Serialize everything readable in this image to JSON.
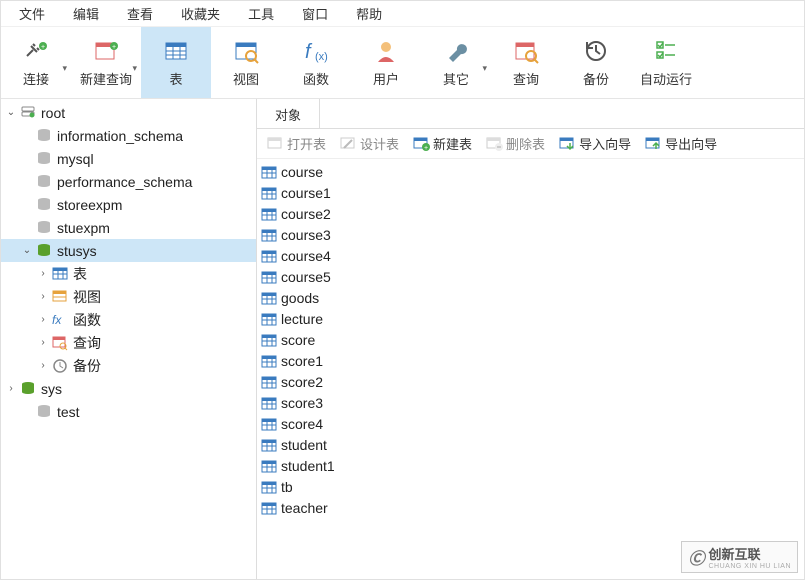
{
  "menu": [
    "文件",
    "编辑",
    "查看",
    "收藏夹",
    "工具",
    "窗口",
    "帮助"
  ],
  "toolbar": [
    {
      "label": "连接",
      "name": "connect",
      "icon": "plug",
      "drop": true,
      "active": false
    },
    {
      "label": "新建查询",
      "name": "new-query",
      "icon": "newq",
      "drop": true,
      "active": false
    },
    {
      "label": "表",
      "name": "tables",
      "icon": "table",
      "drop": false,
      "active": true
    },
    {
      "label": "视图",
      "name": "views",
      "icon": "view",
      "drop": false,
      "active": false
    },
    {
      "label": "函数",
      "name": "functions",
      "icon": "fx",
      "drop": false,
      "active": false
    },
    {
      "label": "用户",
      "name": "users",
      "icon": "user",
      "drop": false,
      "active": false
    },
    {
      "label": "其它",
      "name": "others",
      "icon": "wrench",
      "drop": true,
      "active": false
    },
    {
      "label": "查询",
      "name": "query",
      "icon": "query",
      "drop": false,
      "active": false
    },
    {
      "label": "备份",
      "name": "backup",
      "icon": "backup",
      "drop": false,
      "active": false
    },
    {
      "label": "自动运行",
      "name": "autorun",
      "icon": "autorun",
      "drop": false,
      "active": false
    }
  ],
  "tree": [
    {
      "depth": 0,
      "arrow": "open",
      "icon": "server",
      "label": "root",
      "sel": false
    },
    {
      "depth": 1,
      "arrow": "",
      "icon": "db",
      "label": "information_schema",
      "sel": false
    },
    {
      "depth": 1,
      "arrow": "",
      "icon": "db",
      "label": "mysql",
      "sel": false
    },
    {
      "depth": 1,
      "arrow": "",
      "icon": "db",
      "label": "performance_schema",
      "sel": false
    },
    {
      "depth": 1,
      "arrow": "",
      "icon": "db",
      "label": "storeexpm",
      "sel": false
    },
    {
      "depth": 1,
      "arrow": "",
      "icon": "db",
      "label": "stuexpm",
      "sel": false
    },
    {
      "depth": 1,
      "arrow": "open",
      "icon": "db-open",
      "label": "stusys",
      "sel": true
    },
    {
      "depth": 2,
      "arrow": "closed",
      "icon": "table-s",
      "label": "表",
      "sel": false
    },
    {
      "depth": 2,
      "arrow": "closed",
      "icon": "view-s",
      "label": "视图",
      "sel": false
    },
    {
      "depth": 2,
      "arrow": "closed",
      "icon": "fx-s",
      "label": "函数",
      "sel": false
    },
    {
      "depth": 2,
      "arrow": "closed",
      "icon": "query-s",
      "label": "查询",
      "sel": false
    },
    {
      "depth": 2,
      "arrow": "closed",
      "icon": "backup-s",
      "label": "备份",
      "sel": false
    },
    {
      "depth": 0,
      "arrow": "closed",
      "icon": "db-open",
      "label": "sys",
      "sel": false
    },
    {
      "depth": 1,
      "arrow": "",
      "icon": "db",
      "label": "test",
      "sel": false
    }
  ],
  "content_tab": "对象",
  "content_toolbar": [
    {
      "label": "打开表",
      "icon": "open-t",
      "enabled": false
    },
    {
      "label": "设计表",
      "icon": "design-t",
      "enabled": false
    },
    {
      "label": "新建表",
      "icon": "new-t",
      "enabled": true
    },
    {
      "label": "删除表",
      "icon": "del-t",
      "enabled": false
    },
    {
      "label": "导入向导",
      "icon": "import",
      "enabled": true
    },
    {
      "label": "导出向导",
      "icon": "export",
      "enabled": true
    }
  ],
  "tables": [
    "course",
    "course1",
    "course2",
    "course3",
    "course4",
    "course5",
    "goods",
    "lecture",
    "score",
    "score1",
    "score2",
    "score3",
    "score4",
    "student",
    "student1",
    "tb",
    "teacher"
  ],
  "watermark": {
    "brand": "创新互联",
    "sub": "CHUANG XIN HU LIAN"
  }
}
